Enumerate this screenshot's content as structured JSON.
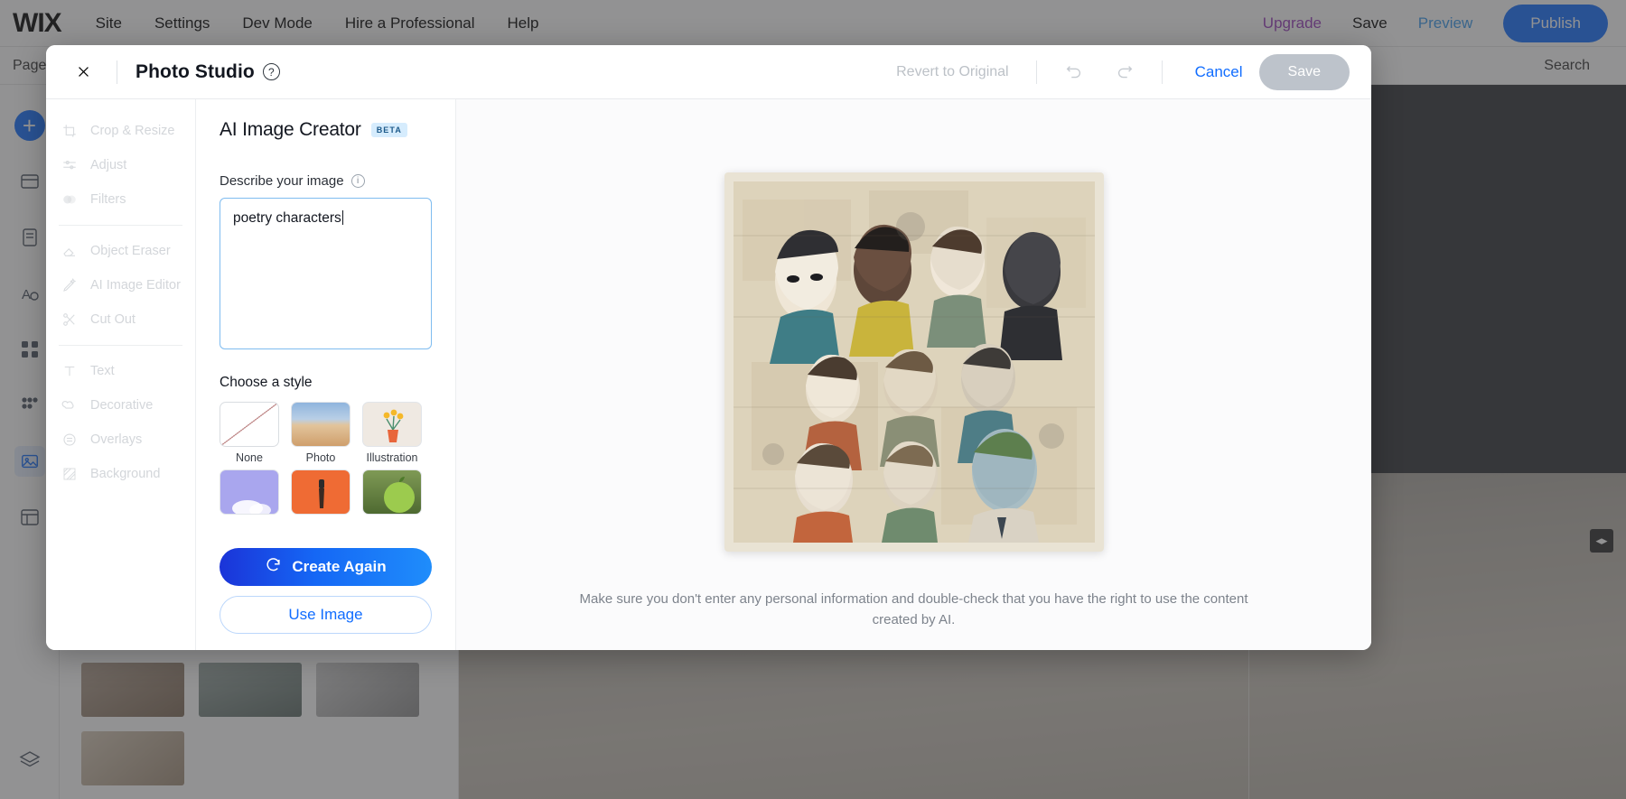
{
  "editor": {
    "logo": "WIX",
    "menu": [
      "Site",
      "Settings",
      "Dev Mode",
      "Hire a Professional",
      "Help"
    ],
    "upgrade": "Upgrade",
    "save": "Save",
    "preview": "Preview",
    "publish": "Publish",
    "pages_label": "Pages",
    "search_label": "Search"
  },
  "modal": {
    "title": "Photo Studio",
    "close_icon": "close-icon",
    "help_icon": "help-icon",
    "revert_label": "Revert to Original",
    "undo_icon": "undo-icon",
    "redo_icon": "redo-icon",
    "cancel_label": "Cancel",
    "save_label": "Save"
  },
  "tools": [
    {
      "label": "Crop & Resize",
      "icon": "crop-icon"
    },
    {
      "label": "Adjust",
      "icon": "sliders-icon"
    },
    {
      "label": "Filters",
      "icon": "filters-icon"
    },
    {
      "label": "Object Eraser",
      "icon": "eraser-icon"
    },
    {
      "label": "AI Image Editor",
      "icon": "magic-brush-icon"
    },
    {
      "label": "Cut Out",
      "icon": "scissors-icon"
    },
    {
      "label": "Text",
      "icon": "text-icon"
    },
    {
      "label": "Decorative",
      "icon": "decorative-icon"
    },
    {
      "label": "Overlays",
      "icon": "overlays-icon"
    },
    {
      "label": "Background",
      "icon": "background-icon"
    }
  ],
  "creator": {
    "title": "AI Image Creator",
    "badge": "BETA",
    "describe_label": "Describe your image",
    "info_icon": "info-icon",
    "prompt_value": "poetry characters",
    "prompt_placeholder": "Describe your image",
    "style_label": "Choose a style",
    "styles": [
      {
        "label": "None",
        "swatch": "sw-none",
        "selected": true
      },
      {
        "label": "Photo",
        "swatch": "sw-photo",
        "selected": false
      },
      {
        "label": "Illustration",
        "swatch": "sw-illus",
        "selected": false
      },
      {
        "label": "",
        "swatch": "sw-3d",
        "selected": false
      },
      {
        "label": "",
        "swatch": "sw-paint",
        "selected": false
      },
      {
        "label": "",
        "swatch": "sw-green",
        "selected": false
      }
    ],
    "create_again_label": "Create Again",
    "create_again_icon": "refresh-icon",
    "use_image_label": "Use Image"
  },
  "preview": {
    "disclaimer": "Make sure you don't enter any personal information and double-check that you have the right to use the content created by AI."
  },
  "colors": {
    "accent": "#116dff",
    "upgrade": "#9a3bbd",
    "beta_bg": "#d6ecfd",
    "disabled": "#bdc3cb",
    "focus_border": "#7fbcf0"
  }
}
